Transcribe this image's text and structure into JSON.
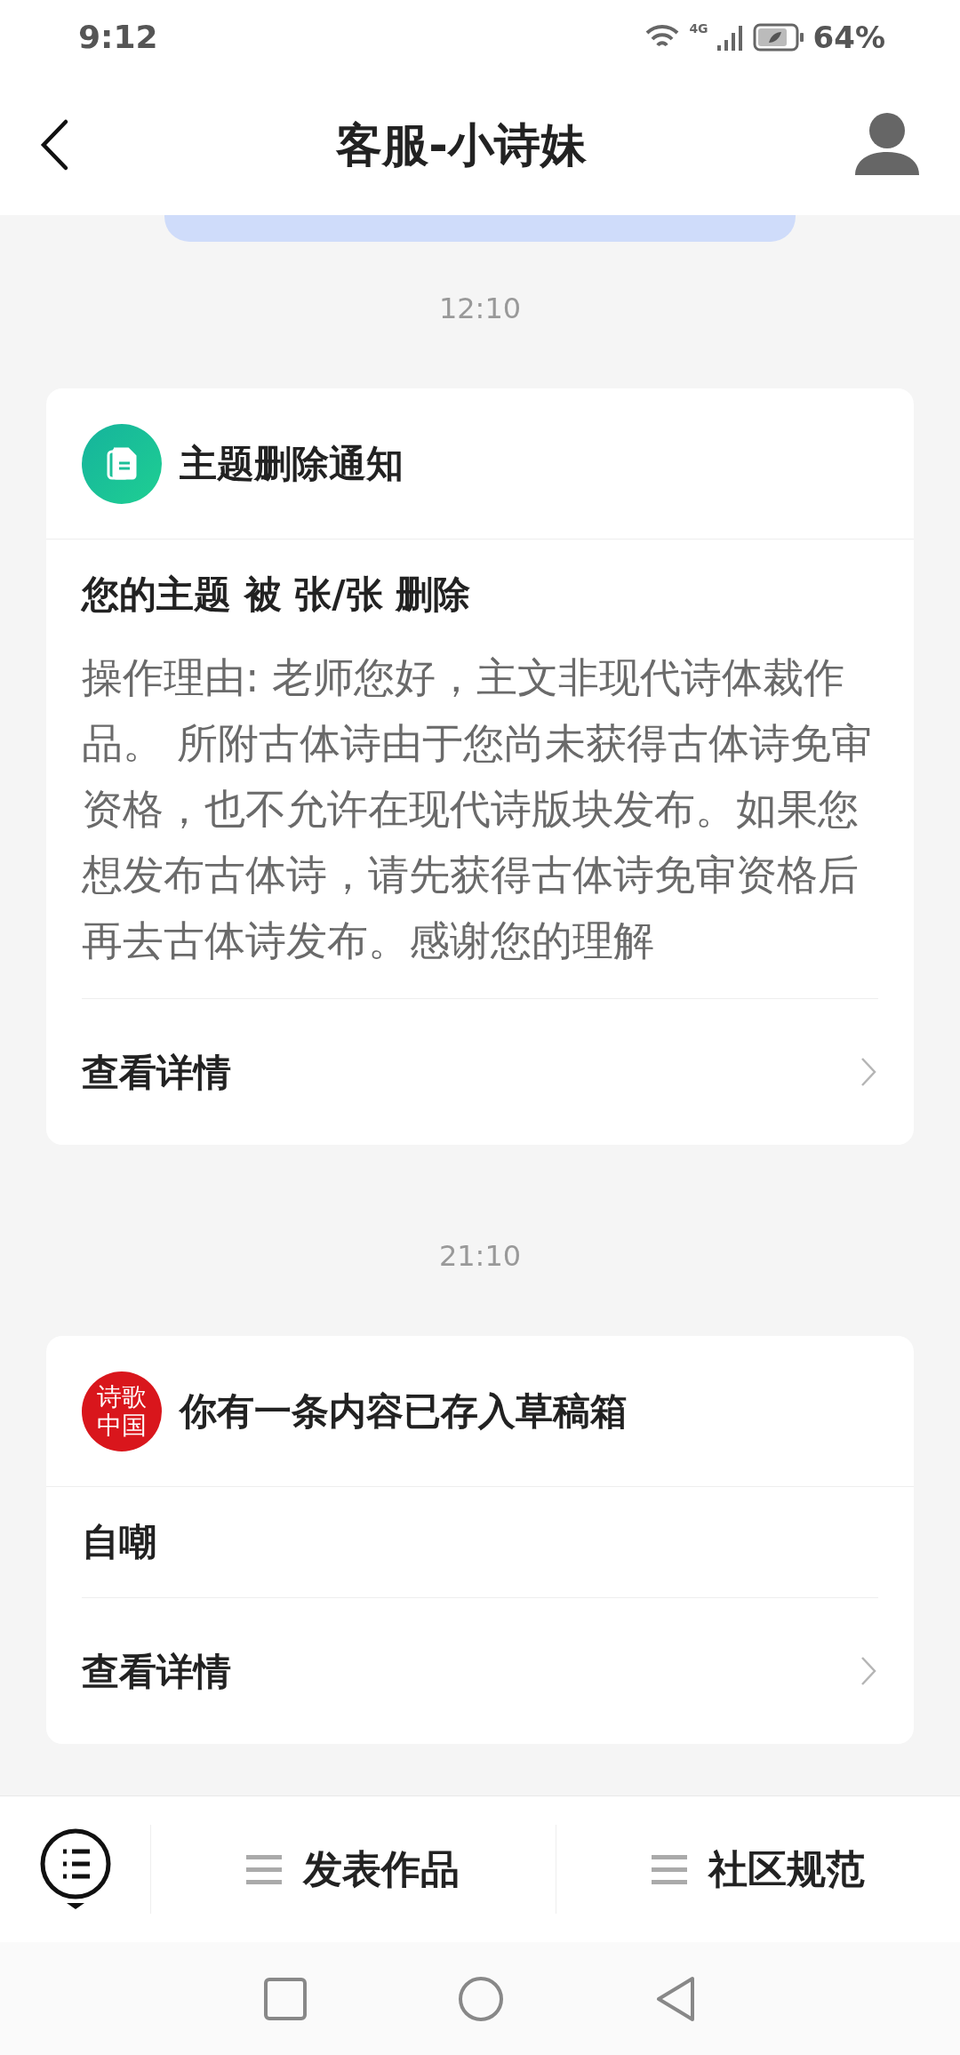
{
  "status_bar": {
    "time": "9:12",
    "network": "4G",
    "battery": "64%"
  },
  "header": {
    "title": "客服-小诗妹"
  },
  "messages": [
    {
      "time": "12:10",
      "kind": "notice",
      "title": "主题删除通知",
      "headline": "您的主题 被 张/张 删除",
      "body": "操作理由: 老师您好，主文非现代诗体裁作品。 所附古体诗由于您尚未获得古体诗免审资格，也不允许在现代诗版块发布。如果您想发布古体诗，请先获得古体诗免审资格后再去古体诗发布。感谢您的理解",
      "link": "查看详情"
    },
    {
      "time": "21:10",
      "kind": "draft",
      "logo_text": "诗歌中国",
      "title": "你有一条内容已存入草稿箱",
      "headline": "自嘲",
      "link": "查看详情"
    }
  ],
  "bottom_menu": [
    "发表作品",
    "社区规范"
  ]
}
